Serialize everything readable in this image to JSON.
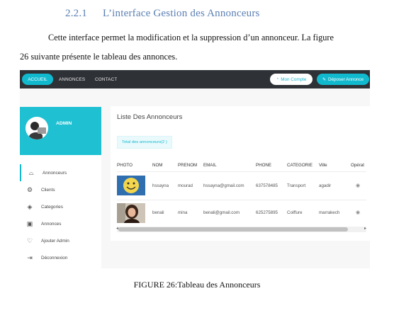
{
  "section": {
    "number": "2.2.1",
    "title": "L’interface Gestion des Annonceurs"
  },
  "paragraph": {
    "line1": "Cette interface permet la modification et  la suppression  d’un annonceur. La figure",
    "line2": "26 suivante présente le tableau des annonces."
  },
  "screenshot": {
    "navbar": {
      "home": "ACCUEIL",
      "links": [
        "ANNONCES",
        "CONTACT"
      ],
      "account_button": "Mon Compte",
      "post_button": "Déposer Annonce"
    },
    "sidebar": {
      "profile_name": "ADMIN",
      "items": [
        {
          "label": "Annonceurs",
          "icon": "megaphone-icon",
          "active": true
        },
        {
          "label": "Clients",
          "icon": "gear-icon",
          "active": false
        },
        {
          "label": "Categories",
          "icon": "layers-icon",
          "active": false
        },
        {
          "label": "Annonces",
          "icon": "picture-icon",
          "active": false
        },
        {
          "label": "Ajouter Admin",
          "icon": "heart-icon",
          "active": false
        },
        {
          "label": "Déconnexion",
          "icon": "logout-icon",
          "active": false
        }
      ]
    },
    "panel": {
      "title": "Liste Des Annonceurs",
      "total": "Total des annonceurs(2 )",
      "columns": [
        "PHOTO",
        "NOM",
        "PRENOM",
        "EMAIL",
        "PHONE",
        "CATEGORIE",
        "Ville",
        "Opérat"
      ],
      "rows": [
        {
          "nom": "hssayna",
          "prenom": "mourad",
          "email": "hssayna@gmail.com",
          "phone": "637578485",
          "categorie": "Transport",
          "ville": "agadir",
          "photo": "smiley-face"
        },
        {
          "nom": "benali",
          "prenom": "mina",
          "email": "benali@gmail.com",
          "phone": "625275895",
          "categorie": "Coiffure",
          "ville": "marrakech",
          "photo": "woman-portrait"
        }
      ]
    },
    "colors": {
      "accent": "#11b9cf",
      "navbar": "#2e3136",
      "profile": "#1ec0d2"
    }
  },
  "caption": "FIGURE 26:Tableau des Annonceurs"
}
